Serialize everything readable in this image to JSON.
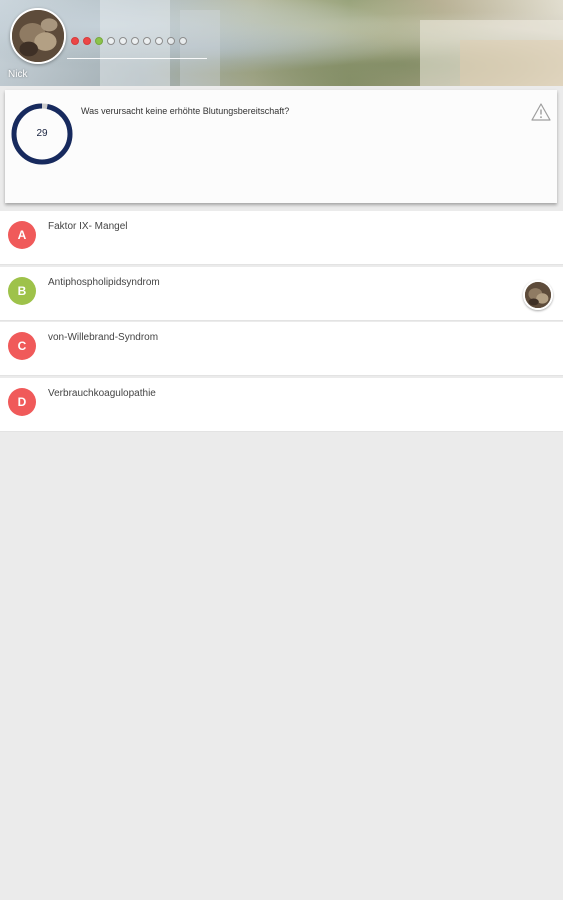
{
  "header": {
    "player_name": "Nick",
    "progress": [
      "wrong",
      "wrong",
      "right",
      "pending",
      "pending",
      "pending",
      "pending",
      "pending",
      "pending",
      "pending"
    ]
  },
  "question": {
    "timer_value": "29",
    "timer_fraction": 0.97,
    "text": "Was verursacht keine erhöhte Blutungsbereitschaft?"
  },
  "answers": [
    {
      "letter": "A",
      "text": "Faktor IX- Mangel",
      "color": "#f05a5a",
      "opponent_marker": false
    },
    {
      "letter": "B",
      "text": "Antiphospholipidsyndrom",
      "color": "#9ec24a",
      "opponent_marker": true
    },
    {
      "letter": "C",
      "text": "von-Willebrand-Syndrom",
      "color": "#f05a5a",
      "opponent_marker": false
    },
    {
      "letter": "D",
      "text": "Verbrauchkoagulopathie",
      "color": "#f05a5a",
      "opponent_marker": false
    }
  ],
  "colors": {
    "timer_ring": "#172a5e",
    "timer_track": "#cccccc",
    "wrong": "#ec4646",
    "right": "#8bc34a"
  }
}
